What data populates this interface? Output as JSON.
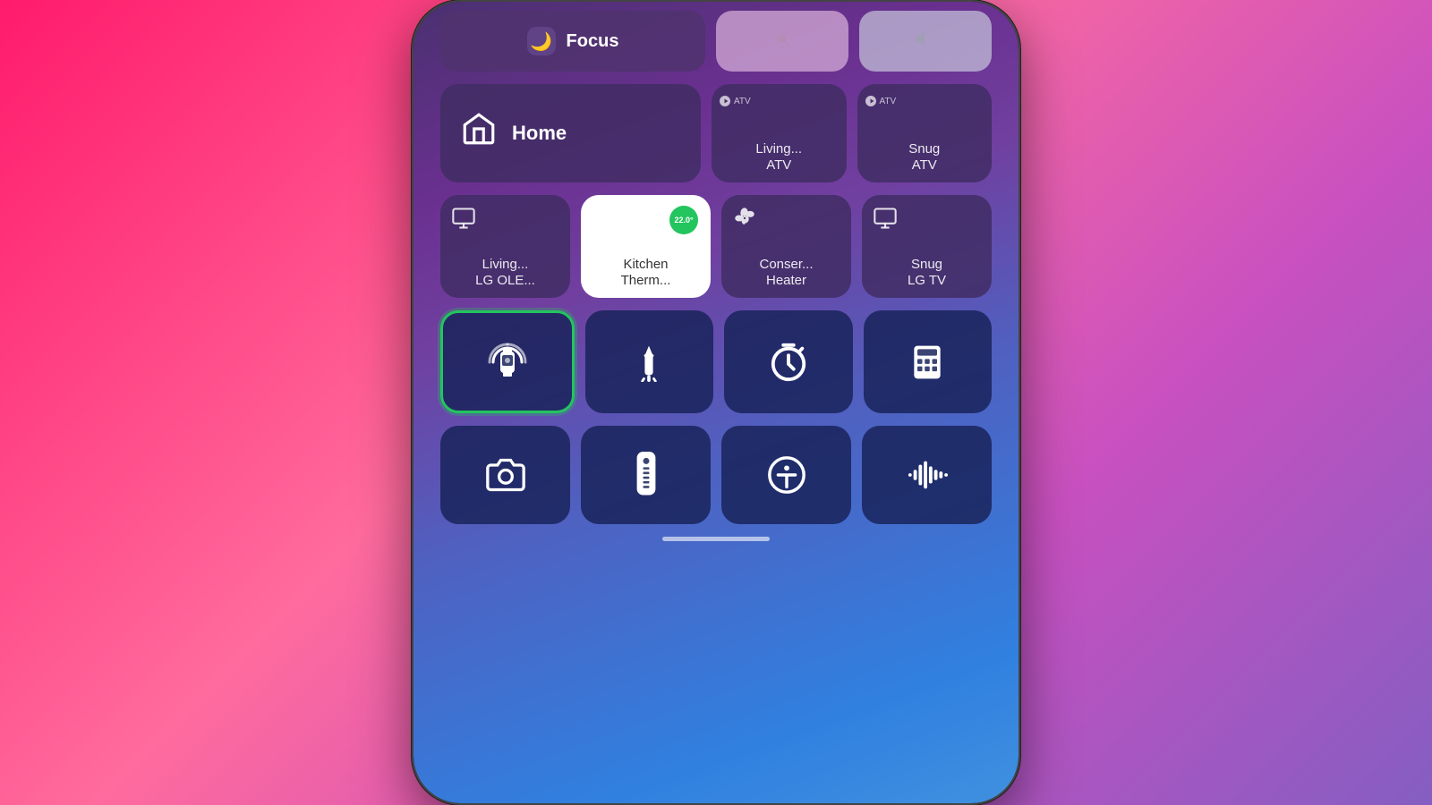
{
  "phone": {
    "background_gradient": "linear-gradient(160deg, #4a3070, #7040a0, #5060c0, #3080e0)"
  },
  "top_row": {
    "focus": {
      "label": "Focus",
      "icon": "🌙"
    },
    "brightness": {
      "icon": "☀️"
    },
    "volume": {
      "icon": "🔊"
    }
  },
  "row2": {
    "home_tile": {
      "label": "Home",
      "icon": "house"
    },
    "living_atv": {
      "brand": "ATV",
      "label": "Living...\nATV"
    },
    "snug_atv": {
      "brand": "ATV",
      "label": "Snug\nATV"
    }
  },
  "row3": {
    "living_lg": {
      "label": "Living...\nLG OLE..."
    },
    "kitchen_therm": {
      "label": "Kitchen\nTherm...",
      "temp": "22.0°"
    },
    "conserv_heater": {
      "label": "Conser...\nHeater"
    },
    "snug_lgtv": {
      "label": "Snug\nLG TV"
    }
  },
  "row4": {
    "watch_ping": {
      "label": "Watch Ping",
      "has_green_border": true
    },
    "flashlight": {
      "label": "Flashlight"
    },
    "timer": {
      "label": "Timer"
    },
    "calculator": {
      "label": "Calculator"
    }
  },
  "row5": {
    "camera": {
      "label": "Camera"
    },
    "remote": {
      "label": "Remote"
    },
    "accessibility": {
      "label": "Accessibility"
    },
    "sound_recognition": {
      "label": "Sound Recognition"
    }
  },
  "colors": {
    "tile_bg": "rgba(65, 45, 100, 0.85)",
    "utility_bg": "rgba(25, 35, 90, 0.85)",
    "green_accent": "#22c55e",
    "white": "#ffffff"
  }
}
